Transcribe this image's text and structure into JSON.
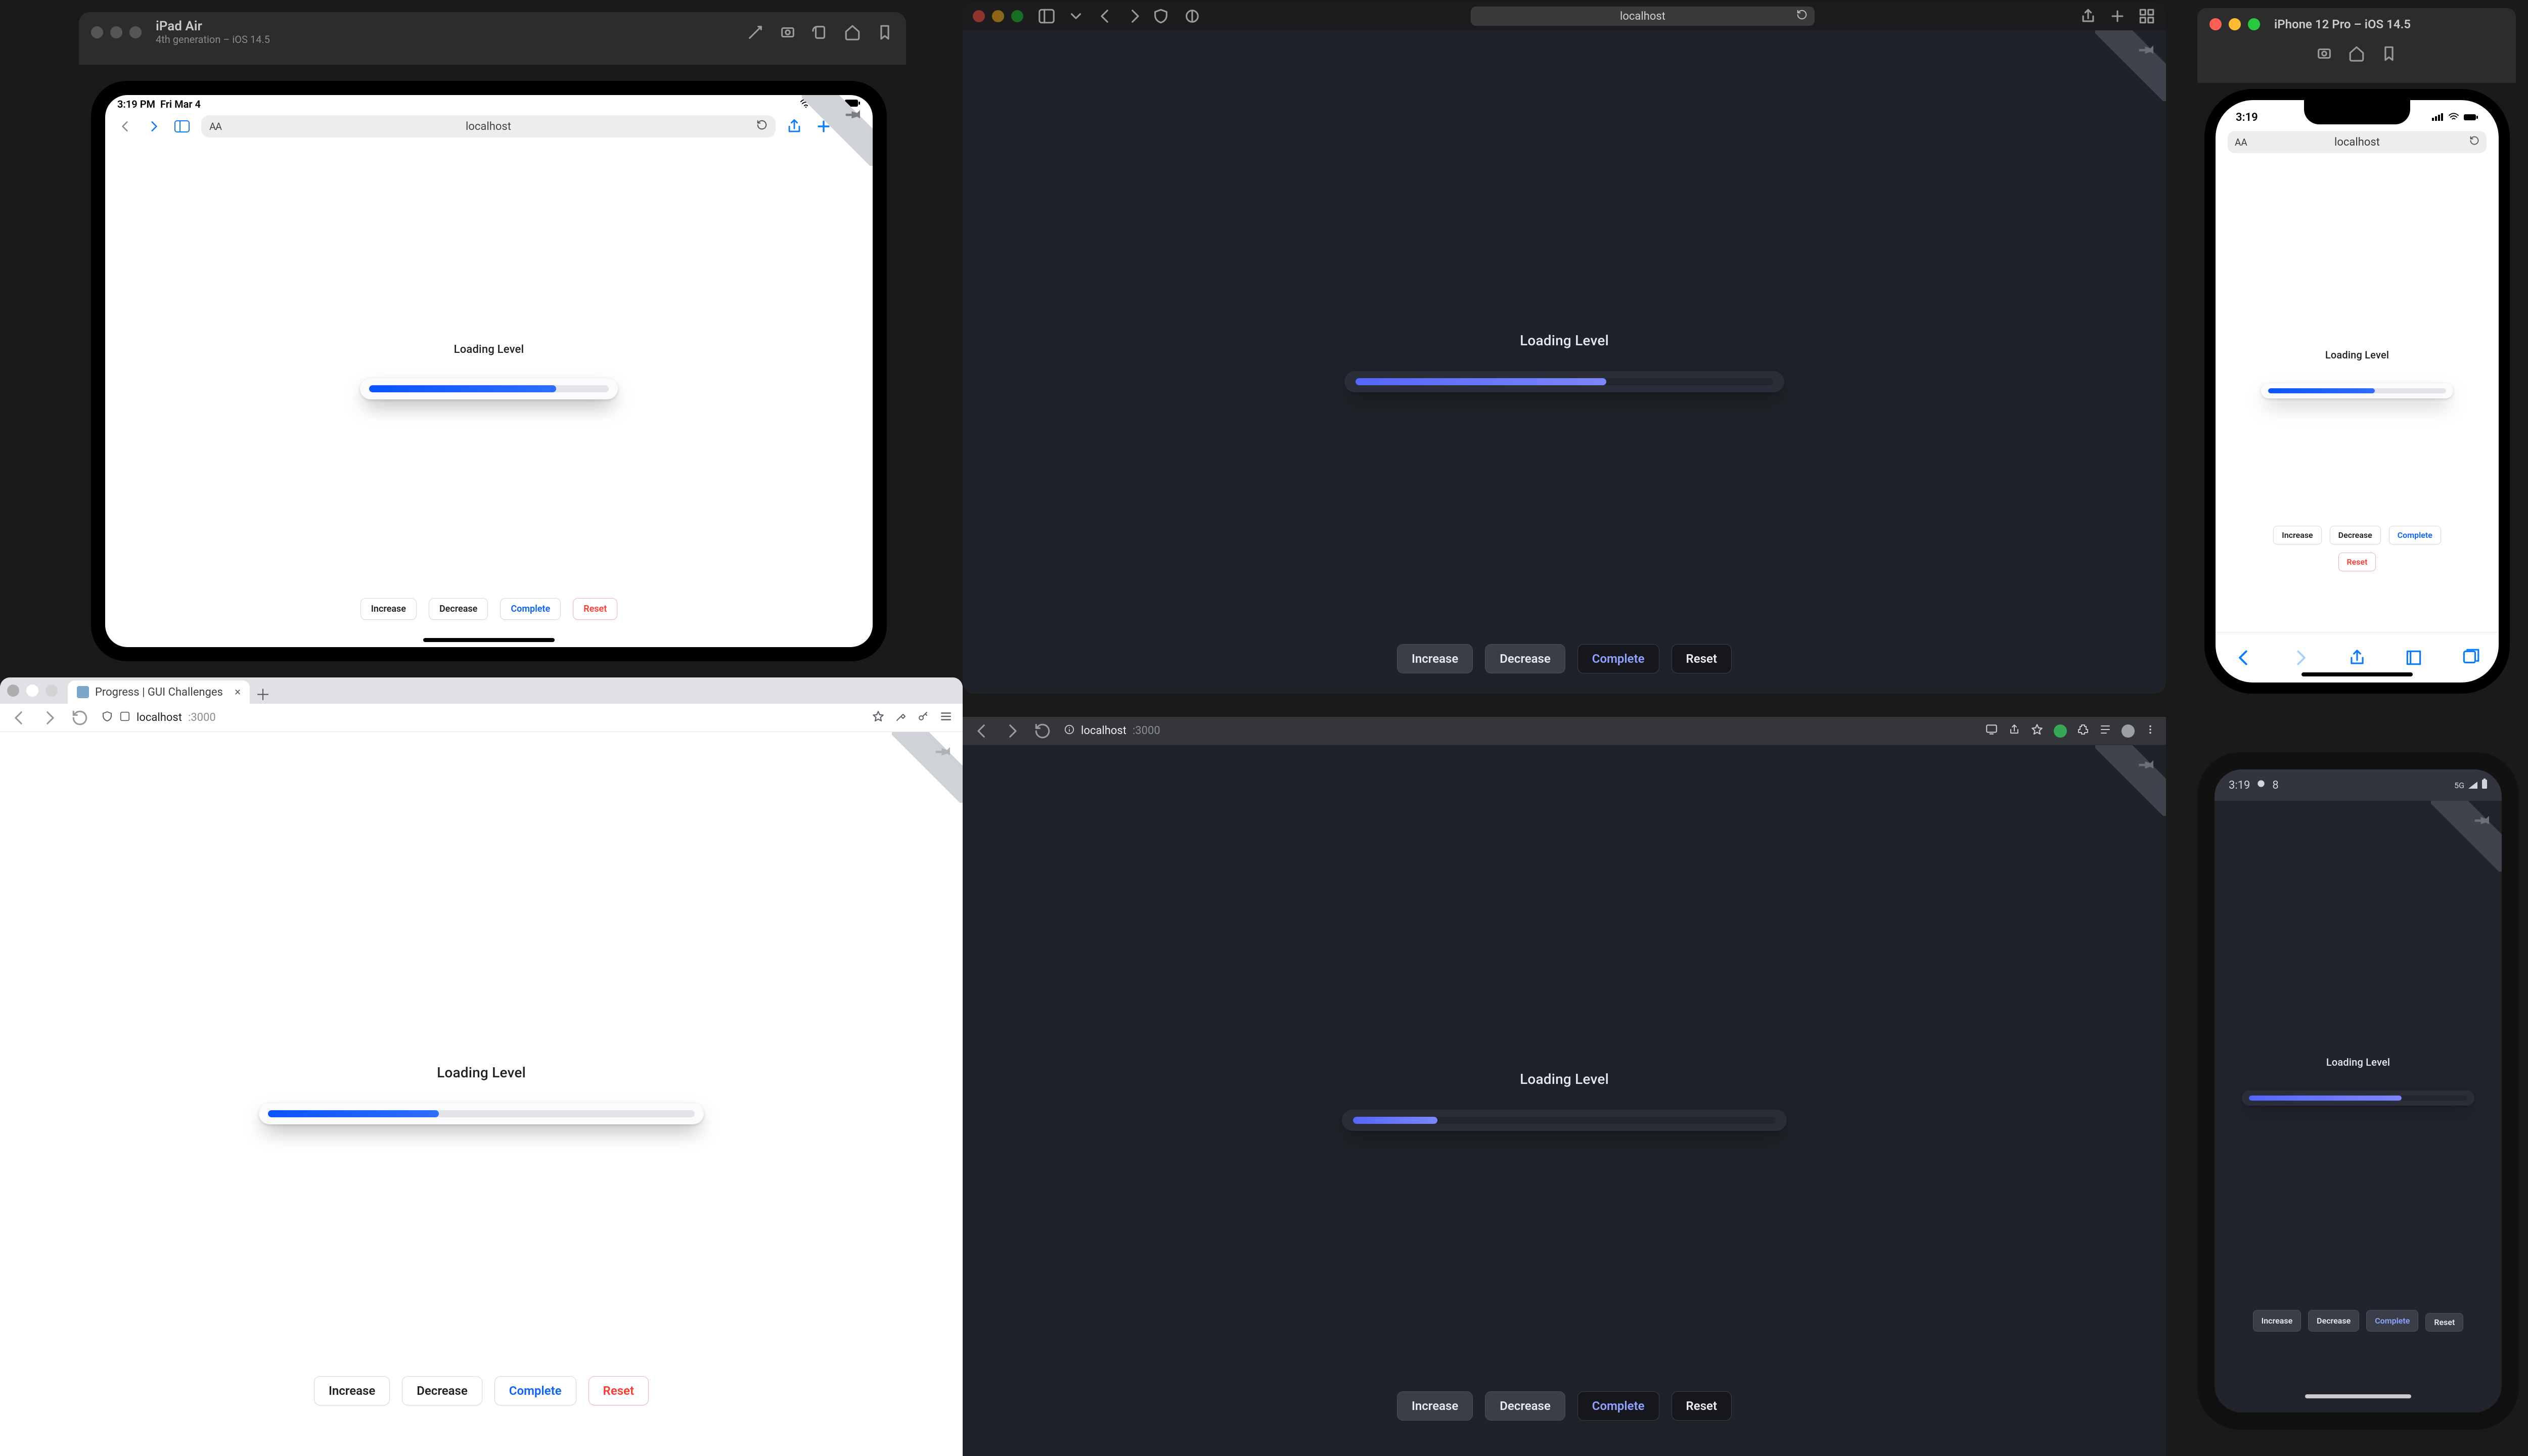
{
  "demo": {
    "heading": "Loading Level",
    "buttons": {
      "increase": "Increase",
      "decrease": "Decrease",
      "complete": "Complete",
      "reset": "Reset"
    },
    "progress": {
      "ipad": 78,
      "safari": 60,
      "chrome_light": 40,
      "chrome_dark": 20,
      "iphone": 60,
      "android": 70
    }
  },
  "ipad_window": {
    "title": "iPad Air",
    "subtitle": "4th generation – iOS 14.5",
    "status": {
      "time": "3:19 PM",
      "date": "Fri Mar 4",
      "wifi": "wifi-icon",
      "battery_pct": "100%",
      "battery": "battery-icon"
    },
    "url": "localhost"
  },
  "safari": {
    "url": "localhost"
  },
  "chrome_light": {
    "tab_title": "Progress | GUI Challenges",
    "host": "localhost",
    "port": ":3000"
  },
  "chrome_dark": {
    "host": "localhost",
    "port": ":3000"
  },
  "iphone_window": {
    "title": "iPhone 12 Pro – iOS 14.5",
    "time": "3:19",
    "url": "localhost"
  },
  "android": {
    "status_time": "3:19",
    "status_icon_label": "8"
  }
}
